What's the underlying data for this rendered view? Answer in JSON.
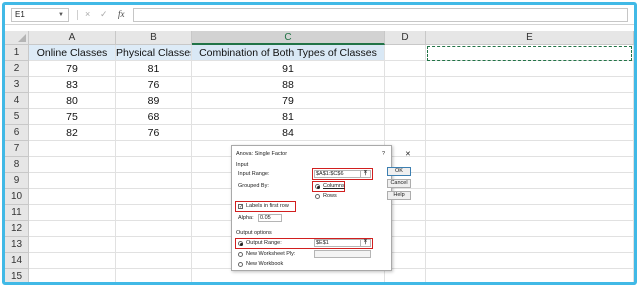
{
  "formula_bar": {
    "name_box": "E1",
    "cancel_icon": "×",
    "enter_icon": "✓",
    "fx_label": "fx",
    "content": ""
  },
  "columns": [
    "A",
    "B",
    "C",
    "D",
    "E"
  ],
  "selected_column": "C",
  "rows": [
    "1",
    "2",
    "3",
    "4",
    "5",
    "6",
    "7",
    "8",
    "9",
    "10",
    "11",
    "12",
    "13",
    "14",
    "15"
  ],
  "sheet": {
    "headers": [
      "Online Classes",
      "Physical Classes",
      "Combination of Both Types of Classes"
    ],
    "data": [
      [
        "79",
        "81",
        "91"
      ],
      [
        "83",
        "76",
        "88"
      ],
      [
        "80",
        "89",
        "79"
      ],
      [
        "75",
        "68",
        "81"
      ],
      [
        "82",
        "76",
        "84"
      ]
    ]
  },
  "dialog": {
    "title": "Anova: Single Factor",
    "help_icon": "?",
    "close_icon": "✕",
    "input_section": "Input",
    "input_range_label": "Input Range:",
    "input_range_value": "$A$1:$C$6",
    "grouped_by_label": "Grouped By:",
    "columns_option": "Columns",
    "rows_option": "Rows",
    "labels_first_row": "Labels in first row",
    "alpha_label": "Alpha:",
    "alpha_value": "0.05",
    "output_options": "Output options",
    "output_range_label": "Output Range:",
    "output_range_value": "$E$1",
    "new_worksheet_label": "New Worksheet Ply:",
    "new_workbook_label": "New Workbook",
    "ok_label": "OK",
    "cancel_label": "Cancel",
    "help_label": "Help",
    "collapse_icon": "⤒"
  },
  "colors": {
    "frame": "#41b9e6",
    "header_fill": "#ddebf7",
    "highlight": "#d11f1f",
    "selection": "#217346"
  }
}
